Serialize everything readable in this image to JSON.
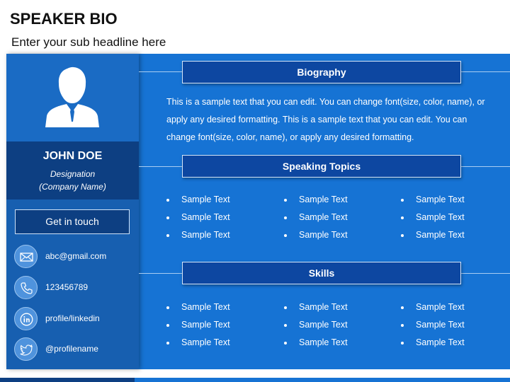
{
  "header": {
    "title": "SPEAKER BIO",
    "subtitle": "Enter your sub headline here"
  },
  "profile": {
    "name": "JOHN DOE",
    "designation": "Designation",
    "company": "(Company Name)",
    "avatar_icon": "person-icon",
    "contact_button": "Get in touch",
    "contacts": [
      {
        "icon": "mail-icon",
        "text": "abc@gmail.com"
      },
      {
        "icon": "phone-icon",
        "text": "123456789"
      },
      {
        "icon": "linkedin-icon",
        "text": "profile/linkedin"
      },
      {
        "icon": "twitter-icon",
        "text": "@profilename"
      }
    ]
  },
  "sections": {
    "biography": {
      "title": "Biography",
      "text": "This is a sample text that you can edit. You can change font(size, color, name), or apply any desired formatting. This is a sample text that you can edit. You can change font(size, color, name), or apply any desired formatting."
    },
    "speaking_topics": {
      "title": "Speaking Topics",
      "columns": [
        [
          "Sample Text",
          "Sample Text",
          "Sample Text"
        ],
        [
          "Sample Text",
          "Sample Text",
          "Sample Text"
        ],
        [
          "Sample Text",
          "Sample Text",
          "Sample Text"
        ]
      ]
    },
    "skills": {
      "title": "Skills",
      "columns": [
        [
          "Sample Text",
          "Sample Text",
          "Sample Text"
        ],
        [
          "Sample Text",
          "Sample Text",
          "Sample Text"
        ],
        [
          "Sample Text",
          "Sample Text",
          "Sample Text"
        ]
      ]
    }
  },
  "colors": {
    "main_blue": "#1673d4",
    "dark_blue": "#0d3f82",
    "panel_blue": "#175fb0",
    "title_box": "#0d47a1"
  }
}
